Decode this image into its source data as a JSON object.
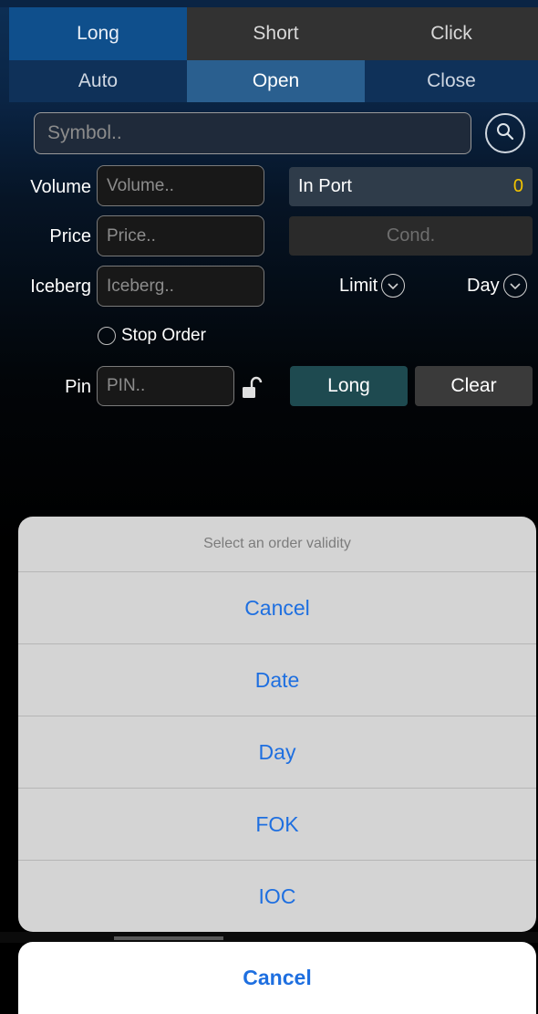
{
  "tabs_top": [
    "Long",
    "Short",
    "Click"
  ],
  "tabs_mode": [
    "Auto",
    "Open",
    "Close"
  ],
  "symbol": {
    "placeholder": "Symbol.."
  },
  "form": {
    "volume_label": "Volume",
    "volume_placeholder": "Volume..",
    "price_label": "Price",
    "price_placeholder": "Price..",
    "iceberg_label": "Iceberg",
    "iceberg_placeholder": "Iceberg..",
    "pin_label": "Pin",
    "pin_placeholder": "PIN..",
    "stop_order_label": "Stop Order"
  },
  "in_port": {
    "label": "In Port",
    "value": "0"
  },
  "cond_label": "Cond.",
  "order_type": "Limit",
  "validity": "Day",
  "buttons": {
    "long": "Long",
    "clear": "Clear"
  },
  "action_sheet": {
    "title": "Select an order validity",
    "options": [
      "Cancel",
      "Date",
      "Day",
      "FOK",
      "IOC"
    ],
    "cancel": "Cancel"
  },
  "colors": {
    "accent_blue": "#1e6fe0",
    "in_port_value": "#f2c300",
    "long_button": "#1e4a50"
  }
}
